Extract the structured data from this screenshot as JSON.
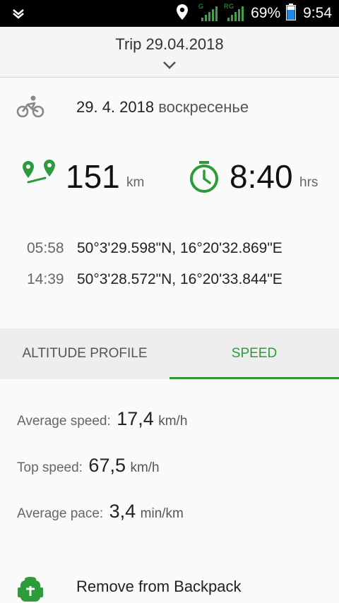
{
  "status_bar": {
    "left_icon": "notification-chevron-icon",
    "location_icon": "location-pin-icon",
    "signal_g_label": "G",
    "signal_r_label": "R",
    "signal_g2_label": "G",
    "battery_percent": "69%",
    "time": "9:54",
    "accent_color": "#43a047"
  },
  "header": {
    "title": "Trip 29.04.2018",
    "expand_icon": "chevron-down-icon"
  },
  "trip": {
    "activity_icon": "bicycle-icon",
    "date": "29. 4. 2018",
    "weekday": "воскресенье",
    "distance_icon": "route-icon",
    "distance_value": "151",
    "distance_unit": "km",
    "duration_icon": "stopwatch-icon",
    "duration_value": "8:40",
    "duration_unit": "hrs",
    "start_time": "05:58",
    "start_coords": "50°3'29.598\"N, 16°20'32.869\"E",
    "end_time": "14:39",
    "end_coords": "50°3'28.572\"N, 16°20'33.844\"E"
  },
  "tabs": [
    {
      "label": "ALTITUDE PROFILE",
      "active": false
    },
    {
      "label": "SPEED",
      "active": true
    }
  ],
  "speed": {
    "average_label": "Average speed:",
    "average_value": "17,4",
    "average_unit": "km/h",
    "top_label": "Top speed:",
    "top_value": "67,5",
    "top_unit": "km/h",
    "pace_label": "Average pace:",
    "pace_value": "3,4",
    "pace_unit": "min/km"
  },
  "backpack": {
    "icon": "backpack-icon",
    "label": "Remove from Backpack"
  },
  "colors": {
    "brand_green": "#2e9b3a",
    "status_bar": "#000000"
  }
}
